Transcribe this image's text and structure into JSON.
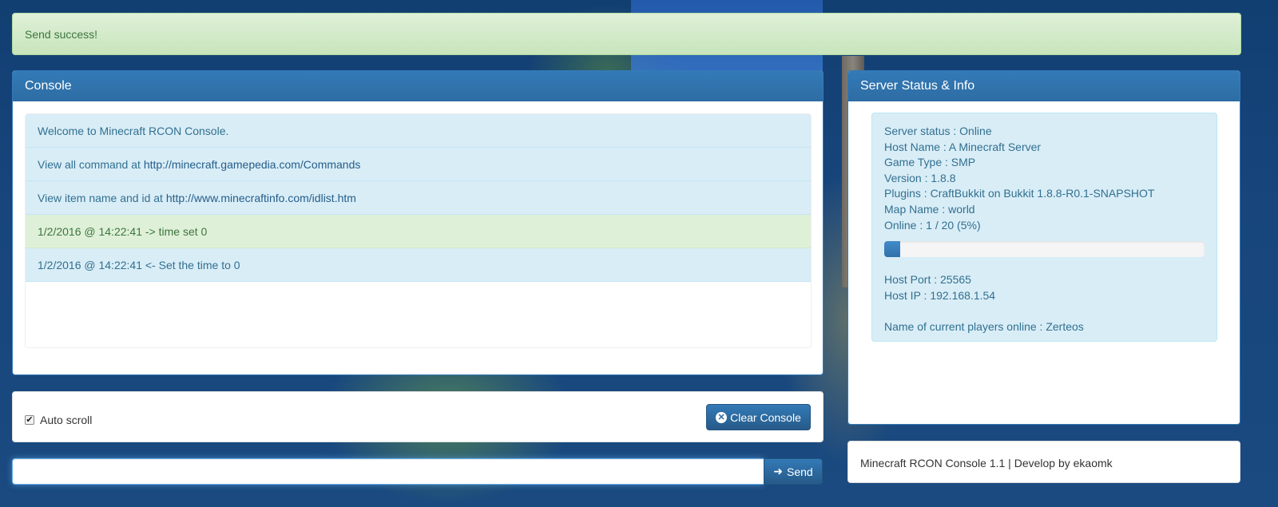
{
  "alert": {
    "text": "Send success!"
  },
  "console": {
    "title": "Console",
    "lines": [
      {
        "text": "Welcome to Minecraft RCON Console.",
        "link": ""
      },
      {
        "text": "View all command at ",
        "link": "http://minecraft.gamepedia.com/Commands"
      },
      {
        "text": "View item name and id at ",
        "link": "http://www.minecraftinfo.com/idlist.htm"
      },
      {
        "text": "1/2/2016 @ 14:22:41 -> time set 0",
        "link": ""
      },
      {
        "text": "1/2/2016 @ 14:22:41 <- Set the time to 0",
        "link": ""
      }
    ]
  },
  "server": {
    "title": "Server Status & Info",
    "status": "Server status : Online",
    "host_name": "Host Name : A Minecraft Server",
    "game_type": "Game Type : SMP",
    "version": "Version : 1.8.8",
    "plugins": "Plugins : CraftBukkit on Bukkit 1.8.8-R0.1-SNAPSHOT",
    "map_name": "Map Name : world",
    "online": "Online : 1 / 20 (5%)",
    "online_fraction": 0.05,
    "host_port": "Host Port : 25565",
    "host_ip": "Host IP : 192.168.1.54",
    "players": "Name of current players online : Zerteos"
  },
  "controls": {
    "auto_scroll_label": "Auto scroll",
    "auto_scroll_checked": true,
    "clear_label": "Clear Console"
  },
  "command": {
    "value": "",
    "send_label": "Send"
  },
  "footer": {
    "text": "Minecraft RCON Console 1.1 | Develop by ekaomk"
  },
  "icons": {
    "clear": "times-circle-icon",
    "send": "arrow-right-icon",
    "check": "checkmark-icon"
  },
  "colors": {
    "primary": "#337ab7",
    "info_bg": "#d9edf7",
    "success_bg": "#dff0d8"
  }
}
